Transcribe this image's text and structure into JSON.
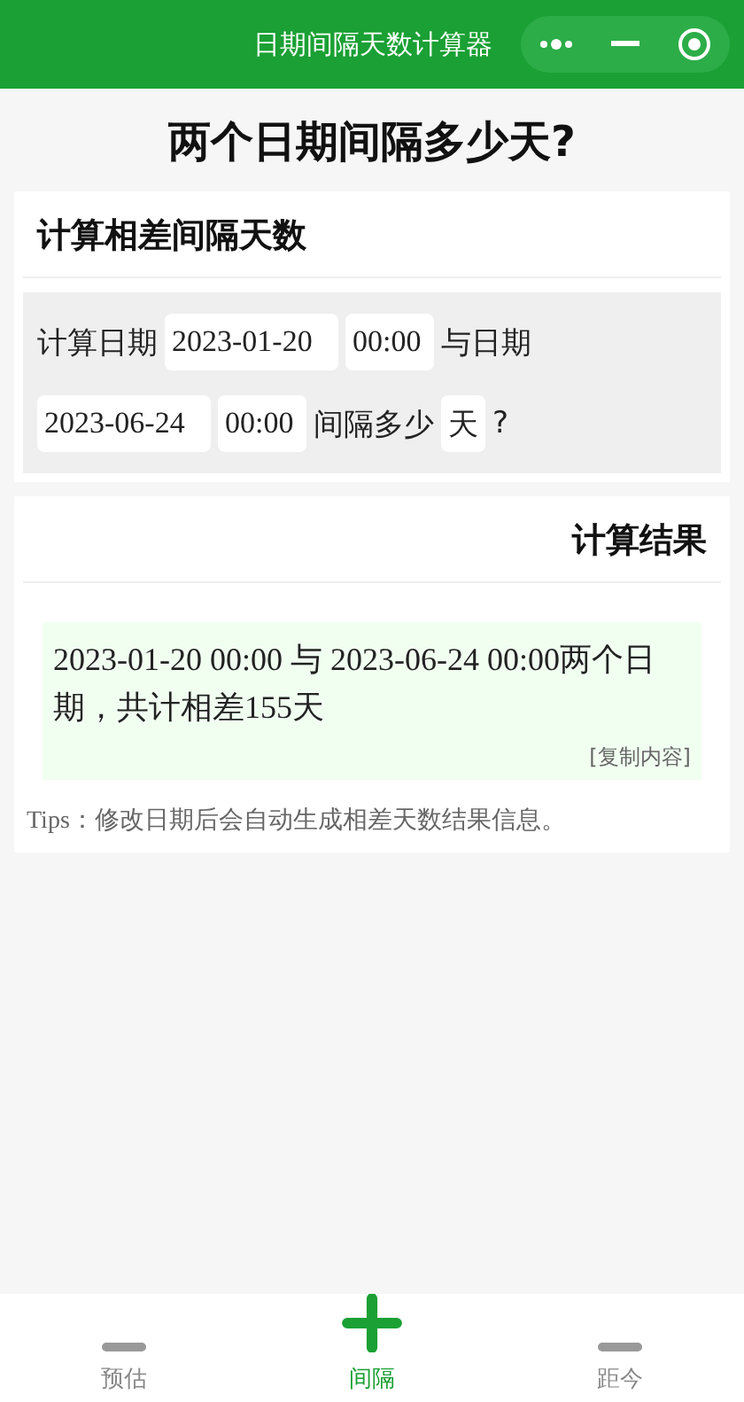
{
  "nav_bar": {
    "title": "日期间隔天数计算器"
  },
  "page_title": "两个日期间隔多少天?",
  "calculator": {
    "title": "计算相差间隔天数",
    "label_start": "计算日期",
    "date_1": "2023-01-20",
    "time_1": "00:00",
    "label_and": "与日期",
    "date_2": "2023-06-24",
    "time_2": "00:00",
    "label_interval": "间隔多少",
    "unit": "天",
    "question_mark": "?"
  },
  "result": {
    "title": "计算结果",
    "text": "2023-01-20 00:00 与 2023-06-24 00:00两个日期，共计相差155天",
    "copy_link": "[复制内容]",
    "tips": "Tips：修改日期后会自动生成相差天数结果信息。"
  },
  "tab_bar": [
    {
      "label": "预估",
      "selected": false
    },
    {
      "label": "间隔",
      "selected": true
    },
    {
      "label": "距今",
      "selected": false
    }
  ]
}
